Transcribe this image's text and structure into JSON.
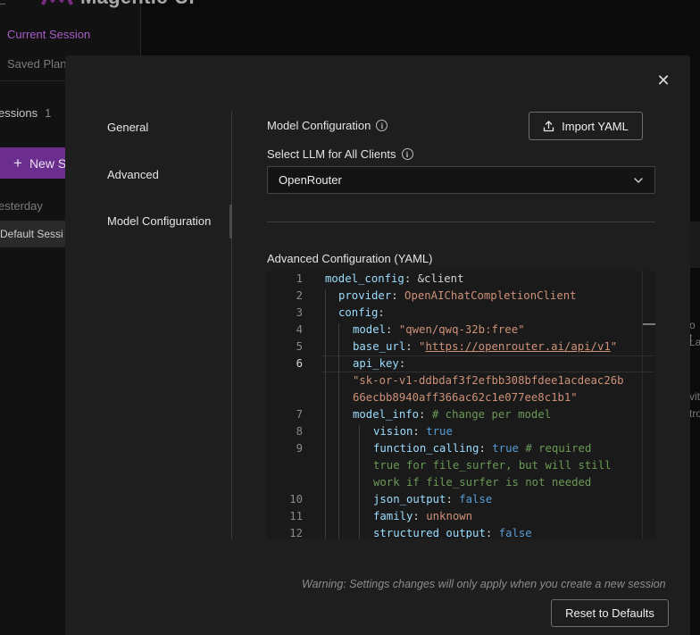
{
  "app": {
    "title": "Magentic-UI"
  },
  "sidebar": {
    "tabs": [
      {
        "label": "Current Session"
      },
      {
        "label": "Saved Plan"
      }
    ],
    "sessions_label": "essions",
    "sessions_count": "1",
    "new_session_label": "New S",
    "group_label": "esterday",
    "session_item": "Default Sessi"
  },
  "background_right": {
    "line1": "o t",
    "line2": "La",
    "line3": "vit",
    "line4": "tro"
  },
  "modal": {
    "close_icon": "close-icon",
    "nav": [
      {
        "label": "General"
      },
      {
        "label": "Advanced"
      },
      {
        "label": "Model Configuration",
        "active": true
      }
    ],
    "section_title": "Model Configuration",
    "import_button": "Import YAML",
    "select_label": "Select LLM for All Clients",
    "select_value": "OpenRouter",
    "yaml_label": "Advanced Configuration (YAML)",
    "line_numbers": [
      "1",
      "2",
      "3",
      "4",
      "5",
      "6",
      "7",
      "8",
      "9",
      "10",
      "11",
      "12"
    ],
    "current_line": "6",
    "warning": "Warning: Settings changes will only apply when you create a new session",
    "reset_button": "Reset to Defaults"
  },
  "yaml": {
    "l1_key": "model_config",
    "l1_val": "&client",
    "l2_key": "provider",
    "l2_val": "OpenAIChatCompletionClient",
    "l3_key": "config",
    "l4_key": "model",
    "l4_val": "\"qwen/qwq-32b:free\"",
    "l5_key": "base_url",
    "l5_q1": "\"",
    "l5_url": "https://openrouter.ai/api/v1",
    "l5_q2": "\"",
    "l6_key": "api_key",
    "l6_val_a": "\"sk-or-v1-ddbdaf3f2efbb308bfdee1acdeac26b",
    "l6_val_b": "66ecbb8940aff366ac62c1e077ee8c1b1\"",
    "l7_key": "model_info",
    "l7_comment": "# change per model",
    "l8_key": "vision",
    "l8_val": "true",
    "l9_key": "function_calling",
    "l9_val": "true",
    "l9_comment_a": "# required",
    "l9_comment_b": "true for file_surfer, but will still",
    "l9_comment_c": "work if file_surfer is not needed",
    "l10_key": "json_output",
    "l10_val": "false",
    "l11_key": "family",
    "l11_val": "unknown",
    "l12_key": "structured_output",
    "l12_val": "false"
  }
}
